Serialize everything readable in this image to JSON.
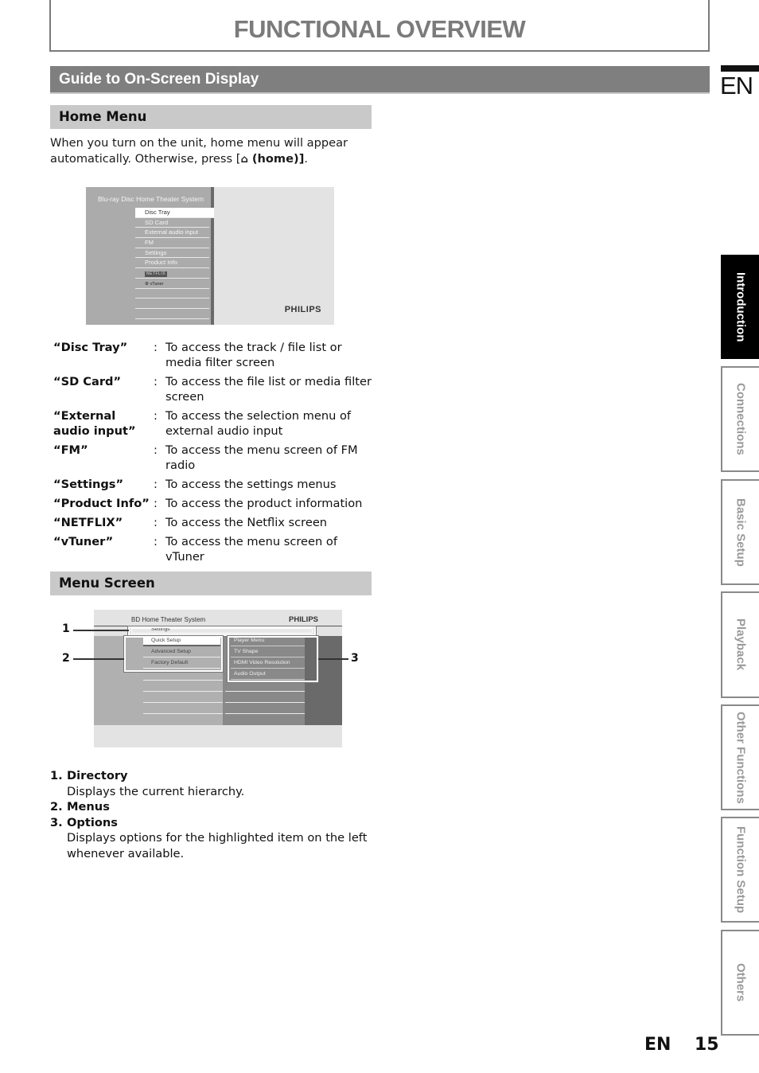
{
  "page_title": "FUNCTIONAL OVERVIEW",
  "section_title": "Guide to On-Screen Display",
  "home_menu": {
    "heading": "Home Menu",
    "intro_part1": "When you turn on the unit, home menu will appear automatically. Otherwise, press [",
    "home_icon": "home-icon",
    "intro_key": " (home)]",
    "intro_end": ".",
    "screen": {
      "system_title": "Blu-ray Disc Home Theater System",
      "items": [
        "Disc Tray",
        "SD Card",
        "External audio input",
        "FM",
        "Settings",
        "Product Info"
      ],
      "netflix_logo": "NETFLIX",
      "vtuner_logo": "vTuner",
      "selected_index": 0,
      "brand": "PHILIPS"
    },
    "definitions": [
      {
        "term": "“Disc Tray”",
        "desc": "To access the track / file list or media filter screen"
      },
      {
        "term": "“SD Card”",
        "desc": "To access the file list or media filter screen"
      },
      {
        "term": "“External audio input”",
        "desc": "To access the selection menu of external audio input"
      },
      {
        "term": "“FM”",
        "desc": "To access the menu screen of FM radio"
      },
      {
        "term": "“Settings”",
        "desc": "To access the settings menus"
      },
      {
        "term": "“Product Info”",
        "desc": "To access the product information"
      },
      {
        "term": "“NETFLIX”",
        "desc": "To access the Netflix screen"
      },
      {
        "term": "“vTuner”",
        "desc": "To access the menu screen of vTuner"
      }
    ],
    "colon": ":"
  },
  "menu_screen": {
    "heading": "Menu Screen",
    "screen": {
      "system_title": "BD Home Theater System",
      "brand": "PHILIPS",
      "directory": "Settings",
      "menus": [
        "Quick Setup",
        "Advanced Setup",
        "Factory Default"
      ],
      "options": [
        "Player Menu",
        "TV Shape",
        "HDMI Video Resolution",
        "Audio Output"
      ]
    },
    "callouts": [
      "1",
      "2",
      "3"
    ],
    "list": [
      {
        "num": "1.",
        "title": "Directory",
        "desc": "Displays the current hierarchy."
      },
      {
        "num": "2.",
        "title": "Menus",
        "desc": ""
      },
      {
        "num": "3.",
        "title": "Options",
        "desc": "Displays options for the highlighted item on the left whenever available."
      }
    ]
  },
  "side_tabs": {
    "language": "EN",
    "tabs": [
      {
        "label": "Introduction",
        "active": true
      },
      {
        "label": "Connections",
        "active": false
      },
      {
        "label": "Basic Setup",
        "active": false
      },
      {
        "label": "Playback",
        "active": false
      },
      {
        "label": "Other Functions",
        "active": false
      },
      {
        "label": "Function Setup",
        "active": false
      },
      {
        "label": "Others",
        "active": false
      }
    ]
  },
  "footer": {
    "language": "EN",
    "page_number": "15"
  }
}
